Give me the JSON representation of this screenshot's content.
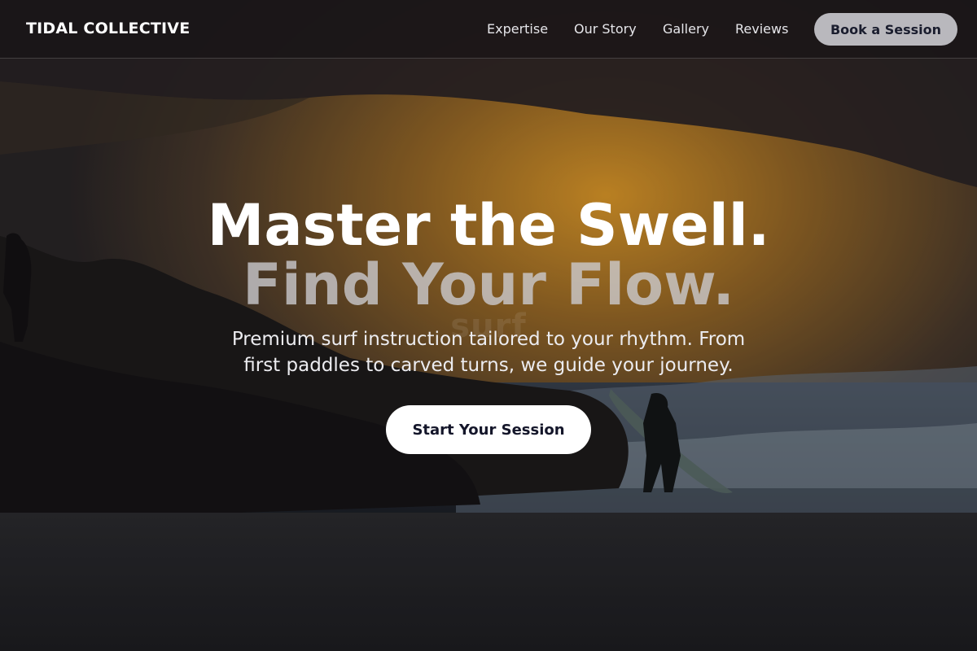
{
  "brand": {
    "name": "TIDAL COLLECTIVE"
  },
  "nav": {
    "links": [
      {
        "label": "Expertise"
      },
      {
        "label": "Our Story"
      },
      {
        "label": "Gallery"
      },
      {
        "label": "Reviews"
      }
    ],
    "cta_label": "Book a Session"
  },
  "hero": {
    "headline_line1": "Master the Swell.",
    "headline_line2": "Find Your Flow.",
    "background_watermark": "surf",
    "subtitle": "Premium surf instruction tailored to your rhythm. From first paddles to carved turns, we guide your journey.",
    "cta_label": "Start Your Session"
  },
  "colors": {
    "nav_cta_bg": "#b9b8bd",
    "nav_cta_text": "#1a1d2e",
    "main_cta_bg": "#ffffff",
    "main_cta_text": "#14162a",
    "sunset_glow": "#e29c2a"
  }
}
